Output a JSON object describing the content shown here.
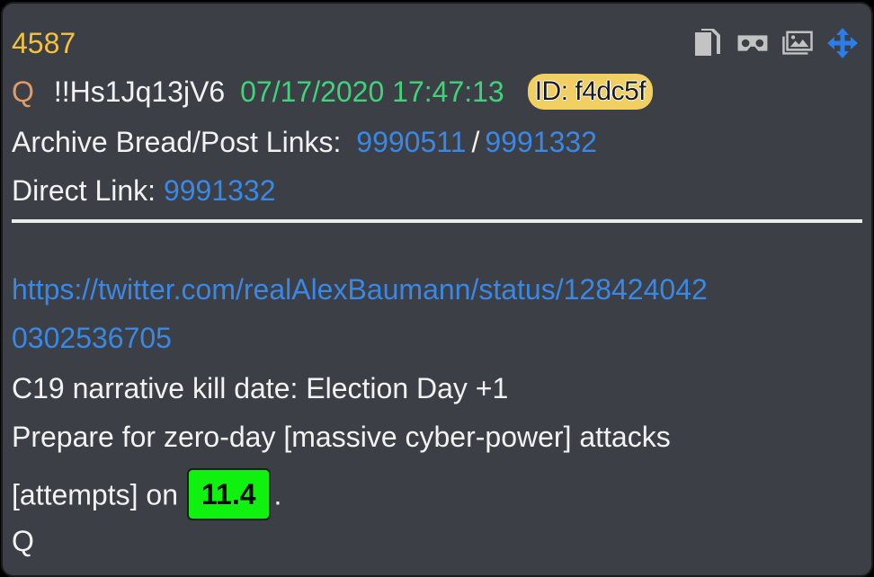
{
  "post": {
    "number": "4587",
    "author": "Q",
    "tripcode": "!!Hs1Jq13jV6",
    "timestamp": "07/17/2020 17:47:13",
    "id_badge": "ID: f4dc5f"
  },
  "links": {
    "archive_label": "Archive Bread/Post Links:",
    "archive_bread": "9990511",
    "separator": "/",
    "archive_post": "9991332",
    "direct_label": "Direct Link:",
    "direct_post": "9991332"
  },
  "toolbar": {
    "icons": [
      "copy-icon",
      "vr-viewer-icon",
      "image-gallery-icon",
      "move-icon"
    ],
    "colors": {
      "gray": "#c3c3c3",
      "blue": "#2a7ee6"
    }
  },
  "body": {
    "url_line_1": "https://twitter.com/realAlexBaumann/status/128424042",
    "url_line_2": "0302536705",
    "line_1": "C19 narrative kill date: Election Day +1",
    "line_2": "Prepare for zero-day [massive cyber-power] attacks",
    "line_3_prefix": "[attempts] on",
    "highlight": "11.4",
    "line_3_suffix": ".",
    "signature": "Q"
  },
  "colors": {
    "background": "#3c3f45",
    "post_number": "#f5c23d",
    "author": "#e29a66",
    "timestamp": "#3fd37a",
    "link": "#3a88e6",
    "id_badge": "#f1cf63",
    "highlight": "#0ff10f",
    "text": "#f2f2f2"
  }
}
